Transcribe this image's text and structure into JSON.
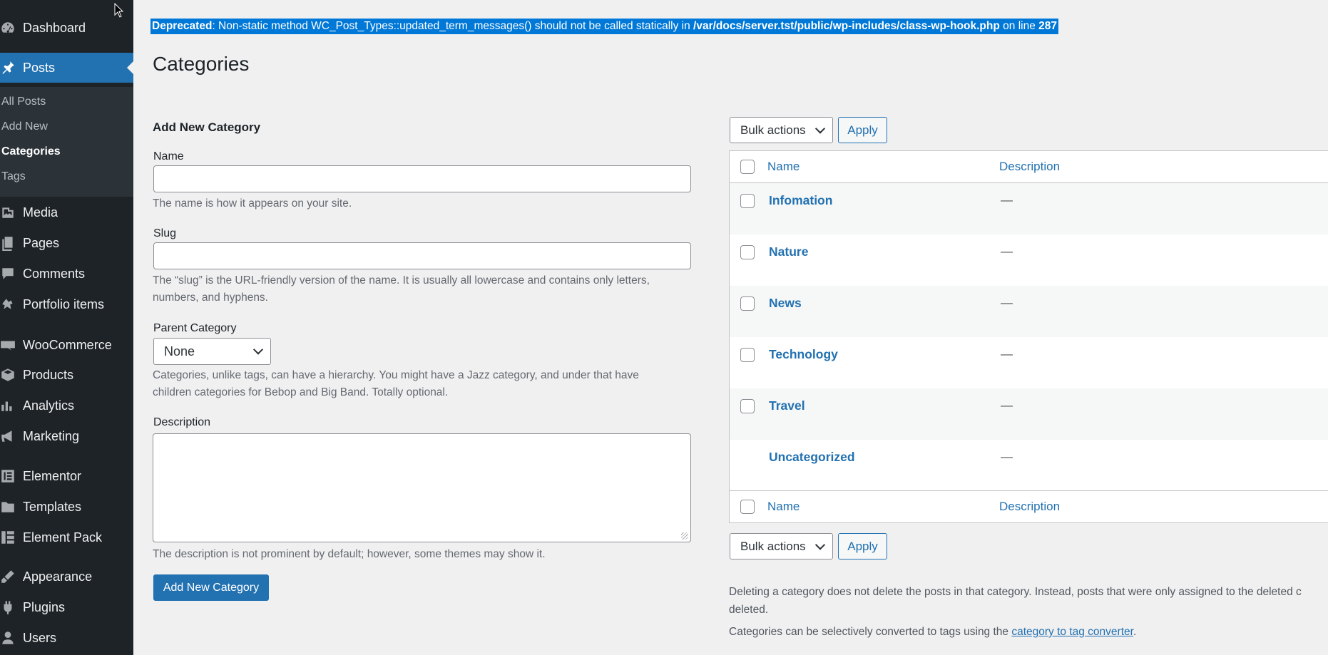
{
  "sidebar": {
    "items": [
      {
        "label": "Dashboard",
        "icon": "dashboard-icon"
      },
      {
        "label": "Posts",
        "icon": "pin-icon"
      },
      {
        "label": "Media",
        "icon": "media-icon"
      },
      {
        "label": "Pages",
        "icon": "pages-icon"
      },
      {
        "label": "Comments",
        "icon": "comments-icon"
      },
      {
        "label": "Portfolio items",
        "icon": "portfolio-icon"
      },
      {
        "label": "WooCommerce",
        "icon": "woocommerce-icon"
      },
      {
        "label": "Products",
        "icon": "products-icon"
      },
      {
        "label": "Analytics",
        "icon": "analytics-icon"
      },
      {
        "label": "Marketing",
        "icon": "marketing-icon"
      },
      {
        "label": "Elementor",
        "icon": "elementor-icon"
      },
      {
        "label": "Templates",
        "icon": "templates-icon"
      },
      {
        "label": "Element Pack",
        "icon": "element-pack-icon"
      },
      {
        "label": "Appearance",
        "icon": "appearance-icon"
      },
      {
        "label": "Plugins",
        "icon": "plugins-icon"
      },
      {
        "label": "Users",
        "icon": "users-icon"
      }
    ],
    "submenu": [
      "All Posts",
      "Add New",
      "Categories",
      "Tags"
    ]
  },
  "notice": {
    "prefix": "Deprecated",
    "message": ": Non-static method WC_Post_Types::updated_term_messages() should not be called statically in ",
    "path": "/var/docs/server.tst/public/wp-includes/class-wp-hook.php",
    "on_line": " on line ",
    "line": "287"
  },
  "page_title": "Categories",
  "form": {
    "heading": "Add New Category",
    "name_label": "Name",
    "name_help": "The name is how it appears on your site.",
    "slug_label": "Slug",
    "slug_help_1": "The “slug” is the URL-friendly version of the name. It is usually all lowercase and contains only letters,",
    "slug_help_2": "numbers, and hyphens.",
    "parent_label": "Parent Category",
    "parent_value": "None",
    "parent_help_1": "Categories, unlike tags, can have a hierarchy. You might have a Jazz category, and under that have",
    "parent_help_2": "children categories for Bebop and Big Band. Totally optional.",
    "description_label": "Description",
    "description_help": "The description is not prominent by default; however, some themes may show it.",
    "submit_label": "Add New Category"
  },
  "table": {
    "bulk_actions": "Bulk actions",
    "apply": "Apply",
    "col_name": "Name",
    "col_description": "Description",
    "rows": [
      {
        "name": "Infomation",
        "description": "—"
      },
      {
        "name": "Nature",
        "description": "—"
      },
      {
        "name": "News",
        "description": "—"
      },
      {
        "name": "Technology",
        "description": "—"
      },
      {
        "name": "Travel",
        "description": "—"
      },
      {
        "name": "Uncategorized",
        "description": "—"
      }
    ]
  },
  "notes": {
    "delete_note_1": "Deleting a category does not delete the posts in that category. Instead, posts that were only assigned to the deleted c",
    "delete_note_2": "deleted.",
    "convert_note": "Categories can be selectively converted to tags using the ",
    "convert_link": "category to tag converter",
    "convert_end": "."
  },
  "colors": {
    "accent": "#2271b1",
    "sidebar_bg": "#1d2327",
    "submenu_bg": "#2c3338",
    "selection": "#0078d7"
  }
}
